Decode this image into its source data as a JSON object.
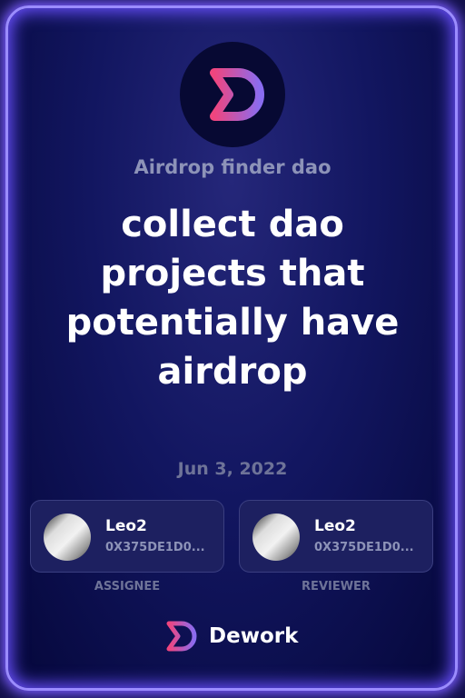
{
  "org_name": "Airdrop finder dao",
  "task_title": "collect dao projects that potentially have airdrop",
  "date": "Jun 3, 2022",
  "assignee": {
    "name": "Leo2",
    "address": "0X375DE1D0...",
    "role": "ASSIGNEE"
  },
  "reviewer": {
    "name": "Leo2",
    "address": "0X375DE1D0...",
    "role": "REVIEWER"
  },
  "brand": "Dework",
  "colors": {
    "accent_pink": "#f0457e",
    "accent_purple": "#8a6cf0",
    "glow": "#9b8cff"
  }
}
